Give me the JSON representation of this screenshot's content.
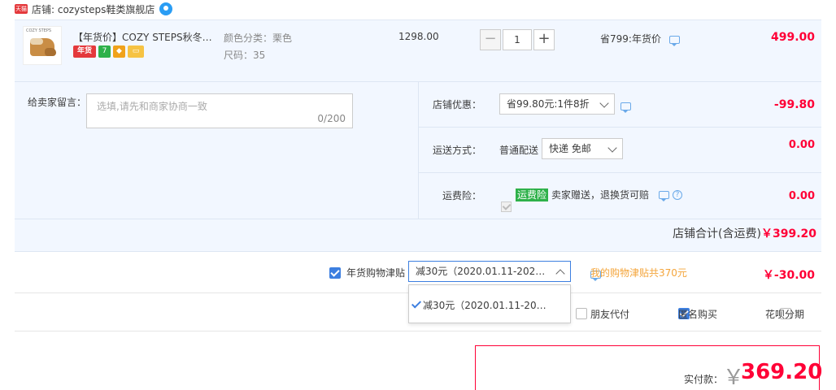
{
  "shop": {
    "badge": "天猫",
    "label": "店铺: cozysteps鞋类旗舰店"
  },
  "item": {
    "thumb_brand": "COZY STEPS",
    "title": "【年货价】COZY STEPS秋冬…",
    "badge_nianhuo": "年货",
    "sku_color": "颜色分类：栗色",
    "sku_size": "尺码：35",
    "unit_price": "1298.00",
    "qty_minus": "−",
    "quantity": "1",
    "qty_plus": "+",
    "saving": "省799:年货价",
    "total": "499.00"
  },
  "message": {
    "label": "给卖家留言：",
    "placeholder": "选填,请先和商家协商一致",
    "count": "0/200"
  },
  "discount": {
    "label": "店铺优惠：",
    "selected": "省99.80元:1件8折",
    "amount": "-99.80"
  },
  "shipping": {
    "label": "运送方式：",
    "method": "普通配送",
    "selected": "快递 免邮",
    "amount": "0.00"
  },
  "insurance": {
    "label": "运费险：",
    "tag": "运费险",
    "text": "卖家赠送，退换货可赔",
    "help": "?",
    "amount": "0.00"
  },
  "subtotal": {
    "label": "店铺合计(含运费)",
    "amount": "￥399.20"
  },
  "subsidy": {
    "label": "年货购物津贴",
    "selected": "减30元（2020.01.11-202…",
    "dropdown_option": "减30元（2020.01.11-20…",
    "link": "我的购物津贴共370元",
    "amount": "￥-30.00"
  },
  "pay_options": {
    "friend_pay": "朋友代付",
    "anonymous": "匿名购买",
    "huabei": "花呗分期"
  },
  "final": {
    "label": "实付款：",
    "currency": "￥",
    "amount": "369.20"
  }
}
